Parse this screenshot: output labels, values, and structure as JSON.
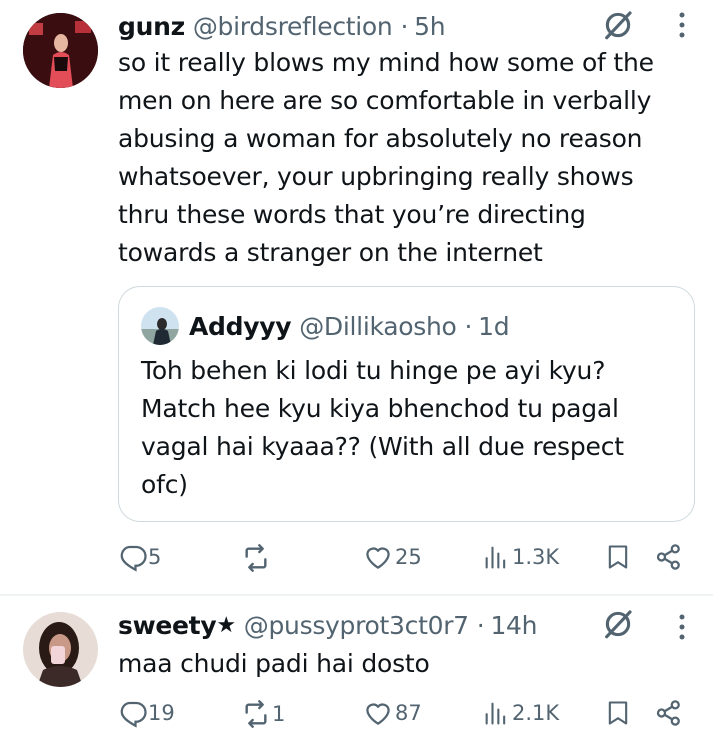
{
  "tweets": [
    {
      "display_name": "gunz",
      "handle": "@birdsreflection",
      "dot": "·",
      "time": "5h",
      "text": "so it really blows my mind how some of the men on here are so comfortable in verbally abusing a woman for absolutely no reason whatsoever, your upbringing really shows thru these words that you’re directing towards a stranger on the internet",
      "quote": {
        "display_name": "Addyyy",
        "handle": "@Dillikaosho",
        "dot": "·",
        "time": "1d",
        "text": "Toh behen ki lodi tu hinge pe ayi kyu? Match hee kyu kiya bhenchod tu pagal vagal hai kyaaa?? (With all due respect ofc)"
      },
      "replies": "5",
      "reposts": "",
      "likes": "25",
      "views": "1.3K"
    },
    {
      "display_name": "sweety",
      "badge": "★",
      "handle": "@pussyprot3ct0r7",
      "dot": "·",
      "time": "14h",
      "text": "maa chudi padi hai dosto",
      "replies": "19",
      "reposts": "1",
      "likes": "87",
      "views": "2.1K"
    }
  ],
  "icons": {
    "reply": "speech-bubble-icon",
    "repost": "repost-arrows-icon",
    "like": "heart-icon",
    "views": "bar-chart-icon",
    "bookmark": "bookmark-icon",
    "share": "share-icon",
    "grok": "grok-slash-icon",
    "more": "more-vertical-icon"
  },
  "colors": {
    "text": "#0f1419",
    "muted": "#536471",
    "border": "#cfd9de"
  }
}
